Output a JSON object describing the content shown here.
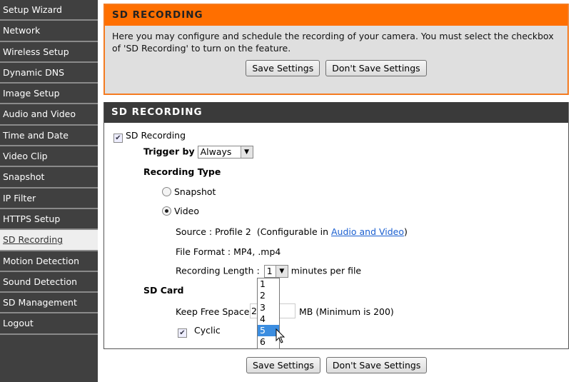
{
  "sidebar": {
    "items": [
      {
        "label": "Setup Wizard"
      },
      {
        "label": "Network"
      },
      {
        "label": "Wireless Setup"
      },
      {
        "label": "Dynamic DNS"
      },
      {
        "label": "Image Setup"
      },
      {
        "label": "Audio and Video"
      },
      {
        "label": "Time and Date"
      },
      {
        "label": "Video Clip"
      },
      {
        "label": "Snapshot"
      },
      {
        "label": "IP Filter"
      },
      {
        "label": "HTTPS Setup"
      },
      {
        "label": "SD Recording",
        "active": true
      },
      {
        "label": "Motion Detection"
      },
      {
        "label": "Sound Detection"
      },
      {
        "label": "SD Management"
      },
      {
        "label": "Logout"
      }
    ]
  },
  "intro": {
    "title": "SD RECORDING",
    "text": "Here you may configure and schedule the recording of your camera. You must select the checkbox of 'SD Recording' to turn on the feature.",
    "save": "Save Settings",
    "dont_save": "Don't Save Settings"
  },
  "form": {
    "title": "SD RECORDING",
    "sd_recording_label": "SD Recording",
    "sd_recording_checked": true,
    "trigger_label": "Trigger by",
    "trigger_value": "Always",
    "recording_type_label": "Recording Type",
    "snapshot_label": "Snapshot",
    "video_label": "Video",
    "selected_type": "Video",
    "source_text": "Source : Profile 2  (Configurable in ",
    "source_link": "Audio and Video",
    "source_end": ")",
    "file_format": "File Format : MP4, .mp4",
    "recording_length_label": "Recording Length :",
    "recording_length_value": "1",
    "recording_length_unit": "minutes per file",
    "recording_length_options": [
      "1",
      "2",
      "3",
      "4",
      "5",
      "6"
    ],
    "highlighted_option": "5",
    "sd_card_label": "SD Card",
    "keep_free_label": "Keep Free Space:",
    "keep_free_value": "200",
    "keep_free_unit": "MB (Minimum is 200)",
    "cyclic_label": "Cyclic",
    "cyclic_checked": true
  },
  "bottom": {
    "save": "Save Settings",
    "dont_save": "Don't Save Settings"
  },
  "colors": {
    "orange_header": "#ff6f00",
    "dark_header": "#3a3a3a",
    "sidebar": "#404040",
    "highlight": "#3b8de0"
  }
}
